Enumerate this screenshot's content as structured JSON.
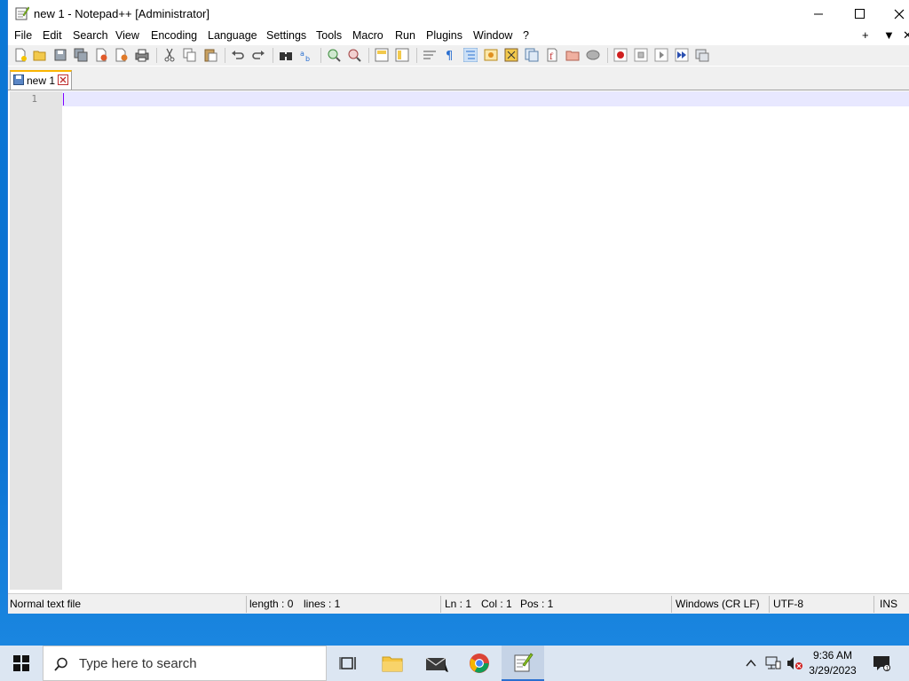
{
  "window": {
    "title": "new 1 - Notepad++ [Administrator]"
  },
  "menu": {
    "items": [
      "File",
      "Edit",
      "Search",
      "View",
      "Encoding",
      "Language",
      "Settings",
      "Tools",
      "Macro",
      "Run",
      "Plugins",
      "Window",
      "?"
    ],
    "right_controls": [
      "+",
      "▼",
      "✕"
    ]
  },
  "toolbar": {
    "buttons": [
      "new-file",
      "open-file",
      "save",
      "save-all",
      "close",
      "close-all",
      "print",
      "cut",
      "copy",
      "paste",
      "undo",
      "redo",
      "find",
      "replace",
      "zoom-in",
      "zoom-out",
      "sync-vertical",
      "sync-horizontal",
      "word-wrap",
      "show-all-chars",
      "indent-guide",
      "user-defined-language",
      "document-map",
      "function-list",
      "folder-as-workspace",
      "doc-switcher",
      "monitoring",
      "record-macro",
      "stop-recording",
      "play-macro",
      "run-macro-multiple",
      "save-macro"
    ]
  },
  "tabs": [
    {
      "label": "new 1"
    }
  ],
  "editor": {
    "line_numbers": [
      "1"
    ],
    "content": ""
  },
  "status": {
    "file_type": "Normal text file",
    "length": "length : 0",
    "lines": "lines : 1",
    "ln": "Ln : 1",
    "col": "Col : 1",
    "pos": "Pos : 1",
    "eol": "Windows (CR LF)",
    "encoding": "UTF-8",
    "mode": "INS"
  },
  "taskbar": {
    "search_placeholder": "Type here to search",
    "apps": [
      "task-view",
      "file-explorer",
      "mail",
      "chrome",
      "notepad-plus-plus"
    ],
    "time": "9:36 AM",
    "date": "3/29/2023"
  },
  "colors": {
    "desktop": "#0a6fd0",
    "caret": "#8000ff",
    "current_line": "#e8e8ff",
    "gutter": "#e4e4e4",
    "tab_accent": "#fab400"
  }
}
